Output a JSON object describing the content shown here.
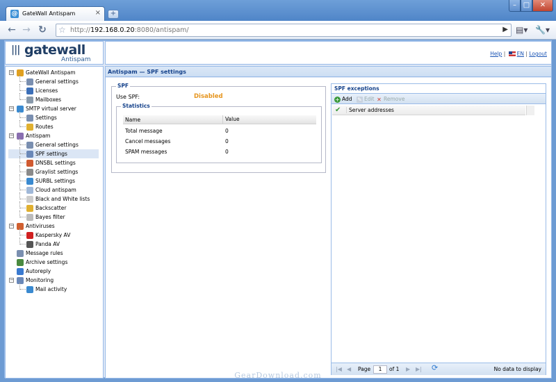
{
  "browser": {
    "tab_title": "GateWall Antispam",
    "tab_favicon": "@",
    "new_tab": "+",
    "url_scheme": "http://",
    "url_host": "192.168.0.20",
    "url_rest": ":8080/antispam/",
    "window_min": "–",
    "window_max": "□",
    "window_close": "✕"
  },
  "logo": {
    "name": "gatewall",
    "sub": "Antispam"
  },
  "header": {
    "help": "Help",
    "lang": "EN",
    "logout": "Logout",
    "sep1": "|",
    "sep2": "|"
  },
  "tree": [
    {
      "label": "GateWall Antispam",
      "level": 0,
      "icon": "gear-icon",
      "color": "#e0a020",
      "expander": "−"
    },
    {
      "label": "General settings",
      "level": 1,
      "icon": "settings-icon",
      "color": "#7a8fb0"
    },
    {
      "label": "Licenses",
      "level": 1,
      "icon": "license-icon",
      "color": "#3c6fb8"
    },
    {
      "label": "Mailboxes",
      "level": 1,
      "icon": "mailbox-icon",
      "color": "#8899aa"
    },
    {
      "label": "SMTP virtual server",
      "level": 0,
      "icon": "globe-icon",
      "color": "#3a8ad0",
      "expander": "−"
    },
    {
      "label": "Settings",
      "level": 1,
      "icon": "settings-icon",
      "color": "#7a8fb0"
    },
    {
      "label": "Routes",
      "level": 1,
      "icon": "routes-icon",
      "color": "#e0b030"
    },
    {
      "label": "Antispam",
      "level": 0,
      "icon": "antispam-icon",
      "color": "#8a6fb0",
      "expander": "−"
    },
    {
      "label": "General settings",
      "level": 1,
      "icon": "settings-icon",
      "color": "#7a8fb0"
    },
    {
      "label": "SPF settings",
      "level": 1,
      "icon": "spf-icon",
      "color": "#6a88b8",
      "selected": true
    },
    {
      "label": "DNSBL settings",
      "level": 1,
      "icon": "dnsbl-icon",
      "color": "#d05a30"
    },
    {
      "label": "Graylist settings",
      "level": 1,
      "icon": "graylist-icon",
      "color": "#8a8a8a"
    },
    {
      "label": "SURBL settings",
      "level": 1,
      "icon": "surbl-icon",
      "color": "#3a8ad0"
    },
    {
      "label": "Cloud antispam",
      "level": 1,
      "icon": "cloud-icon",
      "color": "#a0b8d8"
    },
    {
      "label": "Black and White lists",
      "level": 1,
      "icon": "list-icon",
      "color": "#cccccc"
    },
    {
      "label": "Backscatter",
      "level": 1,
      "icon": "backscatter-icon",
      "color": "#e0b030"
    },
    {
      "label": "Bayes filter",
      "level": 1,
      "icon": "bayes-icon",
      "color": "#bbbbbb"
    },
    {
      "label": "Antiviruses",
      "level": 0,
      "icon": "antivirus-icon",
      "color": "#d06030",
      "expander": "−"
    },
    {
      "label": "Kaspersky AV",
      "level": 1,
      "icon": "kaspersky-icon",
      "color": "#d02020"
    },
    {
      "label": "Panda AV",
      "level": 1,
      "icon": "panda-icon",
      "color": "#555555"
    },
    {
      "label": "Message rules",
      "level": 0,
      "icon": "rules-icon",
      "color": "#7a8fb0"
    },
    {
      "label": "Archive settings",
      "level": 0,
      "icon": "archive-icon",
      "color": "#4a8a40"
    },
    {
      "label": "Autoreply",
      "level": 0,
      "icon": "autoreply-icon",
      "color": "#3a7ad0"
    },
    {
      "label": "Monitoring",
      "level": 0,
      "icon": "monitor-icon",
      "color": "#6a88b8",
      "expander": "−"
    },
    {
      "label": "Mail activity",
      "level": 1,
      "icon": "activity-icon",
      "color": "#3a8ad0"
    }
  ],
  "main": {
    "title": "Antispam — SPF settings",
    "spf": {
      "legend": "SPF",
      "use_label": "Use SPF:",
      "use_value": "Disabled",
      "stats_legend": "Statistics",
      "columns": [
        "Name",
        "Value"
      ],
      "rows": [
        {
          "name": "Total message",
          "value": "0"
        },
        {
          "name": "Cancel messages",
          "value": "0"
        },
        {
          "name": "SPAM messages",
          "value": "0"
        }
      ]
    },
    "exceptions": {
      "title": "SPF exceptions",
      "add": "Add",
      "edit": "Edit",
      "remove": "Remove",
      "row": "Server addresses",
      "pager": {
        "first": "|◀",
        "prev": "◀",
        "page_label": "Page",
        "page_value": "1",
        "of": "of 1",
        "next": "▶",
        "last": "▶|",
        "refresh": "⟳",
        "status": "No data to display"
      }
    }
  },
  "watermark": "GearDownload.com"
}
